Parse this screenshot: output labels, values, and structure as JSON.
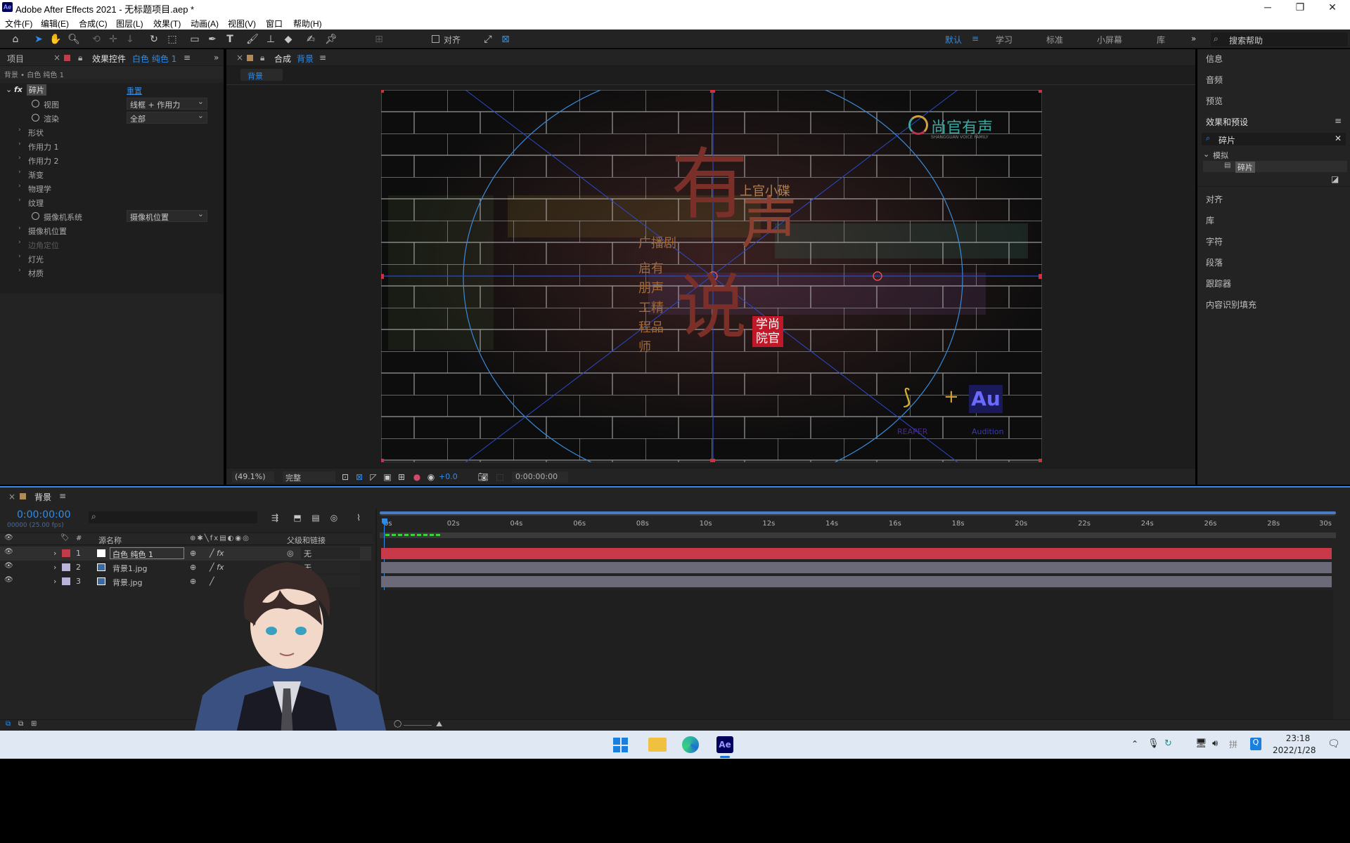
{
  "window": {
    "title": "Adobe After Effects 2021 - 无标题项目.aep *",
    "logo": "Ae"
  },
  "menu": [
    "文件(F)",
    "编辑(E)",
    "合成(C)",
    "图层(L)",
    "效果(T)",
    "动画(A)",
    "视图(V)",
    "窗口",
    "帮助(H)"
  ],
  "toolbar": {
    "align_label": "对齐",
    "workspaces": [
      "默认",
      "学习",
      "标准",
      "小屏幕",
      "库"
    ],
    "active_workspace": "默认",
    "search_placeholder": "搜索帮助"
  },
  "left_panel": {
    "tab_project": "项目",
    "tab_effects": "效果控件",
    "tab_effects_layer": "白色 纯色 1",
    "breadcrumb": "背景 • 白色 纯色 1",
    "effect_name": "碎片",
    "reset_label": "重置",
    "rows": [
      {
        "label": "视图",
        "value": "线框 + 作用力"
      },
      {
        "label": "渲染",
        "value": "全部"
      },
      {
        "label": "形状"
      },
      {
        "label": "作用力 1"
      },
      {
        "label": "作用力 2"
      },
      {
        "label": "渐变"
      },
      {
        "label": "物理学"
      },
      {
        "label": "纹理"
      },
      {
        "label": "摄像机系统",
        "value": "摄像机位置"
      },
      {
        "label": "摄像机位置"
      },
      {
        "label": "边角定位"
      },
      {
        "label": "灯光"
      },
      {
        "label": "材质"
      }
    ]
  },
  "composition": {
    "tab_prefix": "合成",
    "tab_name": "背景",
    "subtab": "背景",
    "zoom": "(49.1%)",
    "quality": "完整",
    "exposure": "+0.0",
    "timecode": "0:00:00:00",
    "overlay": {
      "brand": "尚官有声",
      "brand_sub": "SHANGGUAN VOICE FAMILY",
      "big_chars": [
        "有",
        "声",
        "说"
      ],
      "top_line": "上官小碟",
      "side_lines": [
        "广播剧",
        "启有",
        "朋声",
        "工精",
        "程品",
        "师"
      ],
      "seal": "学尚院官",
      "reaper": "REAPER",
      "plus": "+",
      "au": "Au",
      "audition": "Audition"
    }
  },
  "right_panel": {
    "items_top": [
      "信息",
      "音频",
      "预览"
    ],
    "effects_presets": "效果和预设",
    "search_value": "碎片",
    "category": "模拟",
    "result": "碎片",
    "items_bottom": [
      "对齐",
      "库",
      "字符",
      "段落",
      "跟踪器",
      "内容识别填充"
    ]
  },
  "timeline": {
    "comp_name": "背景",
    "timecode": "0:00:00:00",
    "frames": "00000 (25.00 fps)",
    "col_source": "源名称",
    "col_parent": "父级和链接",
    "ticks": [
      "0s",
      "02s",
      "04s",
      "06s",
      "08s",
      "10s",
      "12s",
      "14s",
      "16s",
      "18s",
      "20s",
      "22s",
      "24s",
      "26s",
      "28s",
      "30s"
    ],
    "layers": [
      {
        "num": "1",
        "name": "白色 纯色 1",
        "parent": "无",
        "color": "#c33a4a"
      },
      {
        "num": "2",
        "name": "背景1.jpg",
        "parent": "无",
        "color": "#b9b3d9"
      },
      {
        "num": "3",
        "name": "背景.jpg",
        "parent": "",
        "color": "#b9b3d9"
      }
    ]
  },
  "taskbar": {
    "time": "23:18",
    "date": "2022/1/28",
    "apps": [
      "windows-start",
      "file-explorer",
      "edge",
      "after-effects"
    ]
  }
}
